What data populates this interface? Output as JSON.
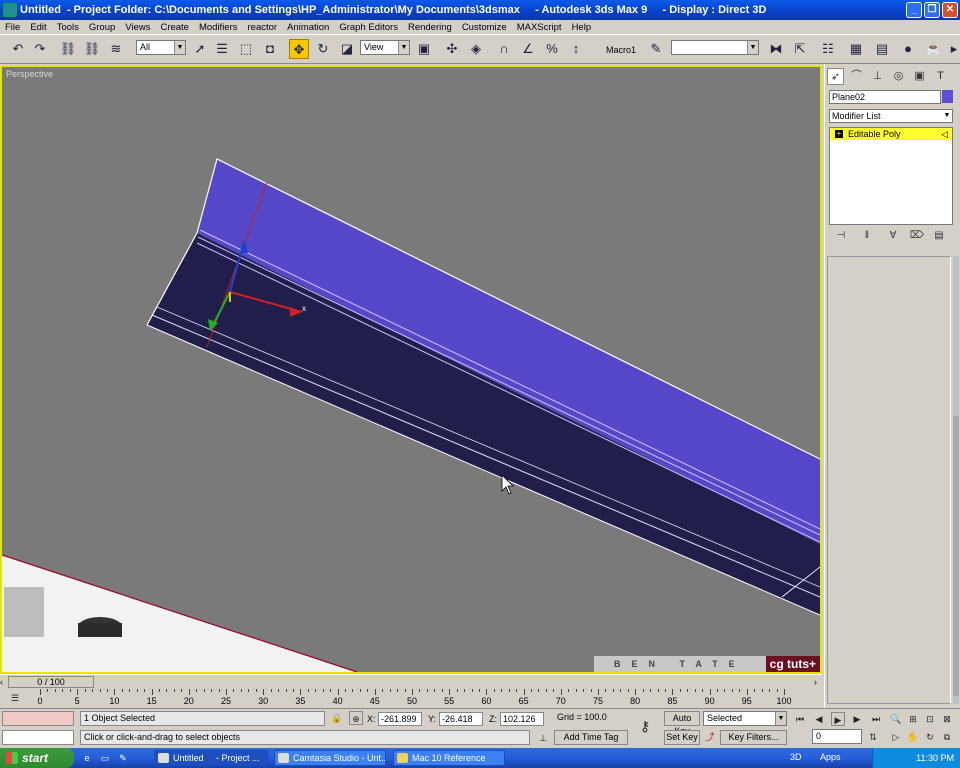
{
  "window": {
    "app_name": "Untitled",
    "title_rest": "- Project Folder: C:\\Documents and Settings\\HP_Administrator\\My Documents\\3dsmax     - Autodesk 3ds Max 9     - Display : Direct 3D",
    "minimize": "_",
    "maximize": "❐",
    "close": "✕"
  },
  "menu": [
    "File",
    "Edit",
    "Tools",
    "Group",
    "Views",
    "Create",
    "Modifiers",
    "reactor",
    "Animation",
    "Graph Editors",
    "Rendering",
    "Customize",
    "MAXScript",
    "Help"
  ],
  "toolbar": {
    "selection_filter": "All",
    "ref_coord": "View",
    "macro_label": "Macro1",
    "named_sel": ""
  },
  "viewport": {
    "label": "Perspective",
    "brand_name": "BEN TATE",
    "brand_logo": "cg tuts+",
    "axis_x": "x"
  },
  "command_panel": {
    "object_name": "Plane02",
    "object_color": "#5b4fd8",
    "modifier_list": "Modifier List",
    "stack_item": "Editable Poly",
    "stack_plus": "+"
  },
  "timeline": {
    "frame_display": "0 / 100",
    "ticks": [
      "0",
      "5",
      "10",
      "15",
      "20",
      "25",
      "30",
      "35",
      "40",
      "45",
      "50",
      "55",
      "60",
      "65",
      "70",
      "75",
      "80",
      "85",
      "90",
      "95",
      "100"
    ]
  },
  "status": {
    "selection": "1 Object Selected",
    "prompt": "Click or click-and-drag to select objects",
    "x_label": "X:",
    "x_value": "-261.899",
    "y_label": "Y:",
    "y_value": "-26.418",
    "z_label": "Z:",
    "z_value": "102.126",
    "grid": "Grid = 100.0",
    "add_time_tag": "Add Time Tag",
    "auto_key": "Auto Key",
    "set_key": "Set Key",
    "key_mode": "Selected",
    "key_filters": "Key Filters...",
    "current_frame": "0"
  },
  "taskbar": {
    "start": "start",
    "tasks": [
      "Untitled     - Project ...",
      "Camtasia Studio - Unt...",
      "Mac 10 Reference"
    ],
    "tray_text": "3D",
    "apps": "Apps",
    "clock": "11:30 PM"
  }
}
